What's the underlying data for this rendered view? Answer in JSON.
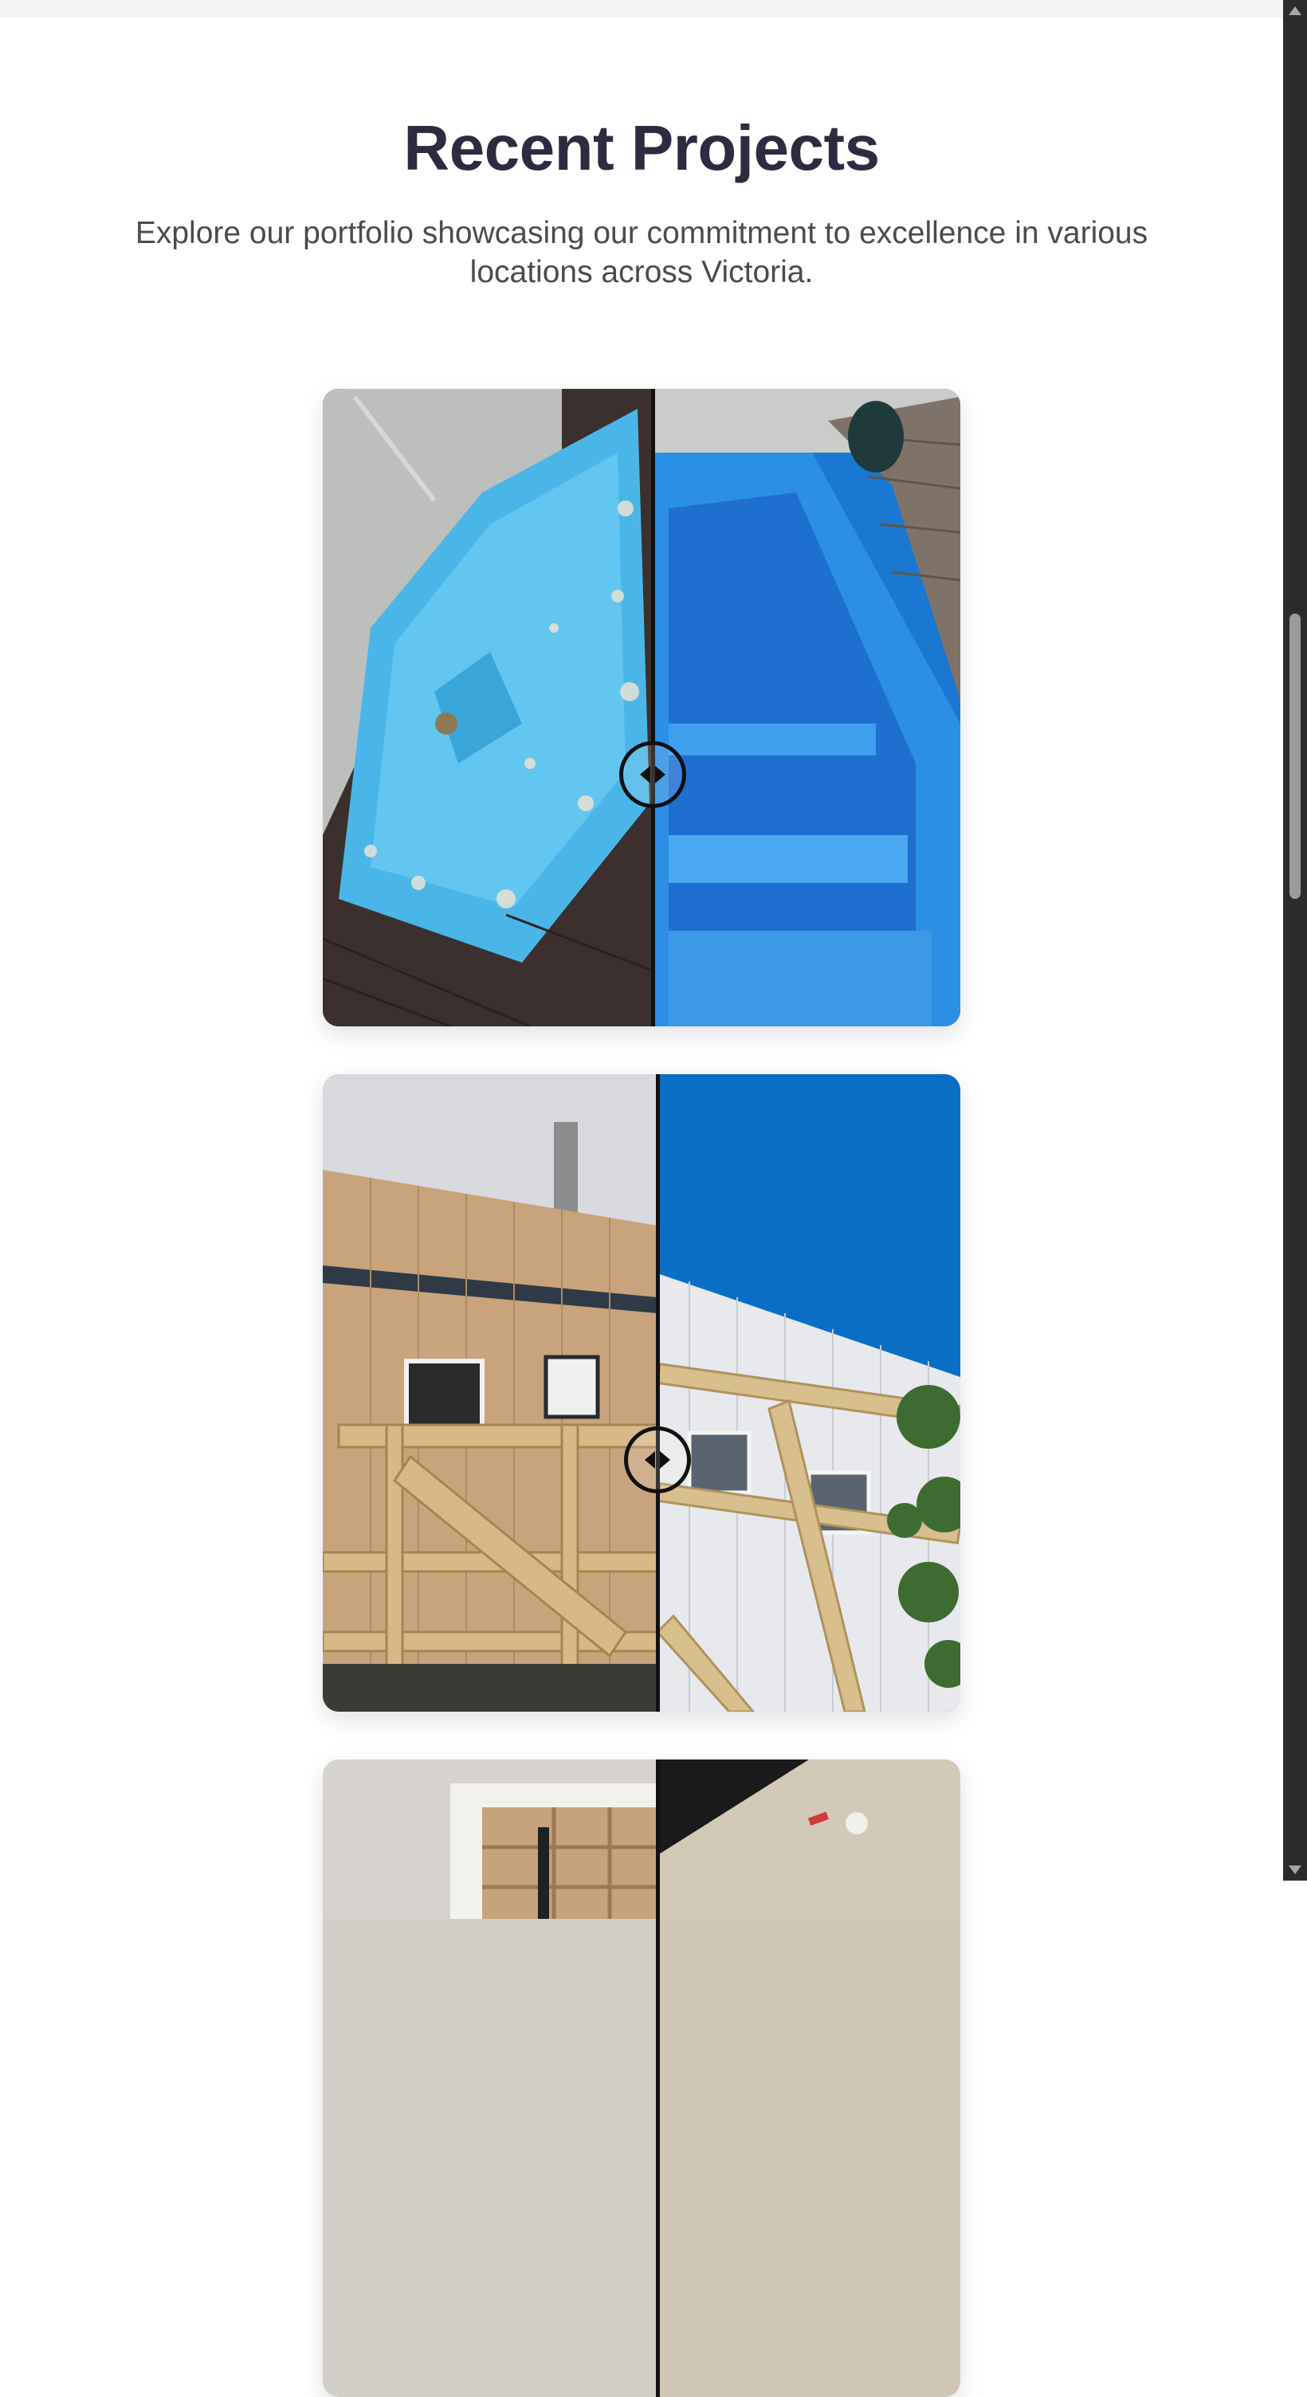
{
  "section": {
    "title": "Recent Projects",
    "subtitle": "Explore our portfolio showcasing our commitment to excellence in various locations across Victoria."
  },
  "projects": [
    {
      "before_image": "fiberglass spa before resurfacing",
      "after_image": "fiberglass spa after resurfacing in bright blue",
      "handle_icon": "left-right-arrows-icon"
    },
    {
      "before_image": "house exterior with timber cladding and scaffolding",
      "after_image": "house exterior with white cladding under blue sky",
      "handle_icon": "left-right-arrows-icon"
    },
    {
      "before_image": "interior with open shelving and doorway",
      "after_image": "interior ceiling with smoke detector",
      "handle_icon": "left-right-arrows-icon"
    }
  ],
  "colors": {
    "heading": "#2c2b40",
    "subtitle": "#4a4a4f",
    "divider": "#111111"
  }
}
